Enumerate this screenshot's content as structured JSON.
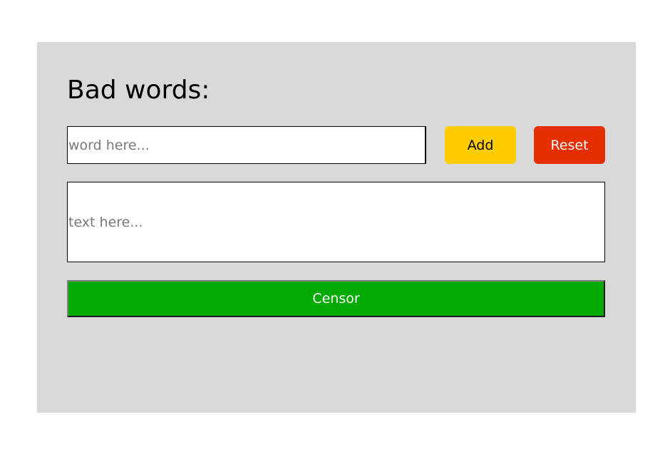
{
  "heading": "Bad words:",
  "word_input": {
    "placeholder": "word here...",
    "value": ""
  },
  "buttons": {
    "add_label": "Add",
    "reset_label": "Reset",
    "censor_label": "Censor"
  },
  "text_area": {
    "placeholder": "text here...",
    "value": ""
  },
  "colors": {
    "panel_bg": "#d9d9d9",
    "add_bg": "#ffcc00",
    "reset_bg": "#e62e00",
    "censor_bg": "#00aa00"
  }
}
